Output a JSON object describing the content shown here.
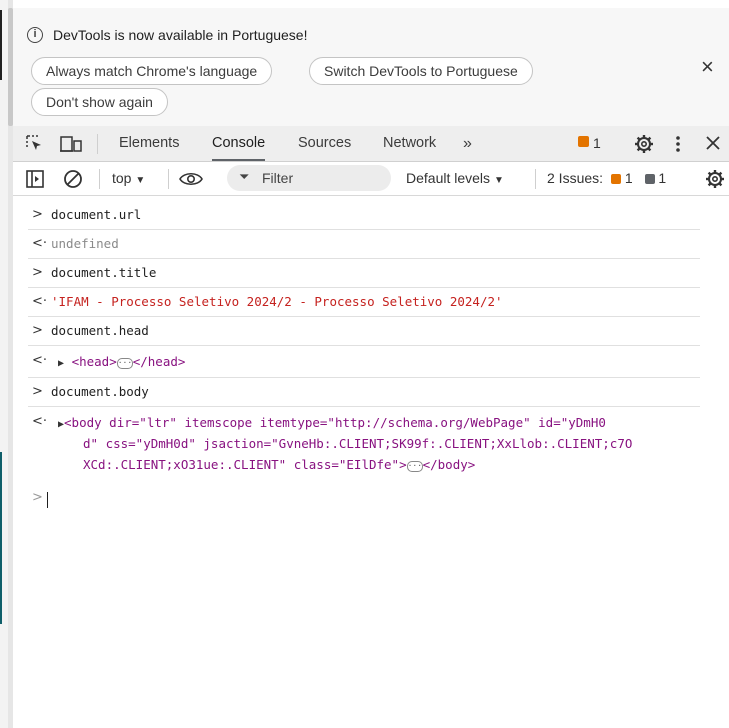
{
  "infobar": {
    "message": "DevTools is now available in Portuguese!",
    "buttons": [
      "Always match Chrome's language",
      "Switch DevTools to Portuguese",
      "Don't show again"
    ],
    "close": "×"
  },
  "tabs": [
    "Elements",
    "Console",
    "Sources",
    "Network"
  ],
  "more_tabs": "»",
  "issues_badge_count": "1",
  "toolbar": {
    "context": "top",
    "filter_placeholder": "Filter",
    "levels": "Default levels",
    "issues_label": "2 Issues:",
    "warn_count": "1",
    "info_count": "1"
  },
  "console": [
    {
      "type": "input",
      "prompt": ">",
      "text": "document.url"
    },
    {
      "type": "output",
      "prompt": "<·",
      "text": "undefined"
    },
    {
      "type": "input",
      "prompt": ">",
      "text": "document.title"
    },
    {
      "type": "output",
      "prompt": "<·",
      "text": "'IFAM - Processo Seletivo 2024/2 - Processo Seletivo 2024/2'"
    },
    {
      "type": "input",
      "prompt": ">",
      "text": "document.head"
    },
    {
      "type": "output",
      "prompt": "<·",
      "open_tag": "<head>",
      "close_tag": "</head>"
    },
    {
      "type": "input",
      "prompt": ">",
      "text": "document.body"
    },
    {
      "type": "output",
      "prompt": "<·",
      "line1": "<body dir=\"ltr\" itemscope itemtype=\"http://schema.org/WebPage\" id=\"yDmH0",
      "line2": "d\" css=\"yDmH0d\" jsaction=\"GvneHb:.CLIENT;SK99f:.CLIENT;XxLlob:.CLIENT;c7O",
      "line3_pre": "XCd:.CLIENT;xO31ue:.CLIENT\" class=\"EIlDfe\">",
      "line3_post": "</body>"
    }
  ],
  "input_prompt": ">",
  "colors": {
    "accent_orange": "#e37400",
    "string_red": "#c5221f"
  }
}
